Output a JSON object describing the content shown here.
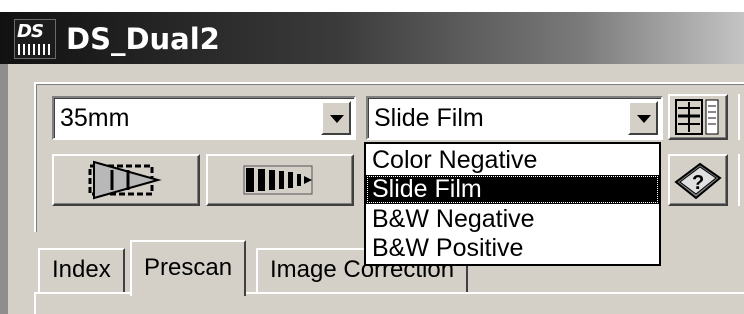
{
  "window": {
    "title": "DS_Dual2",
    "app_icon": "ds-scanner-app-icon",
    "app_icon_text": "DS"
  },
  "film_format": {
    "value": "35mm"
  },
  "film_type": {
    "value": "Slide Film",
    "options": [
      "Color Negative",
      "Slide Film",
      "B&W Negative",
      "B&W Positive"
    ],
    "selected_index": 1
  },
  "toolbar": {
    "buttons": [
      {
        "name": "index-scan-button",
        "icon": "index-scan-icon"
      },
      {
        "name": "eject-film-button",
        "icon": "eject-film-icon"
      },
      {
        "name": "settings-stack-button",
        "icon": "settings-stack-icon"
      },
      {
        "name": "help-book-button",
        "icon": "help-book-icon"
      }
    ]
  },
  "tabs": [
    {
      "label": "Index",
      "active": false
    },
    {
      "label": "Prescan",
      "active": true
    },
    {
      "label": "Image Correction",
      "active": false
    }
  ]
}
